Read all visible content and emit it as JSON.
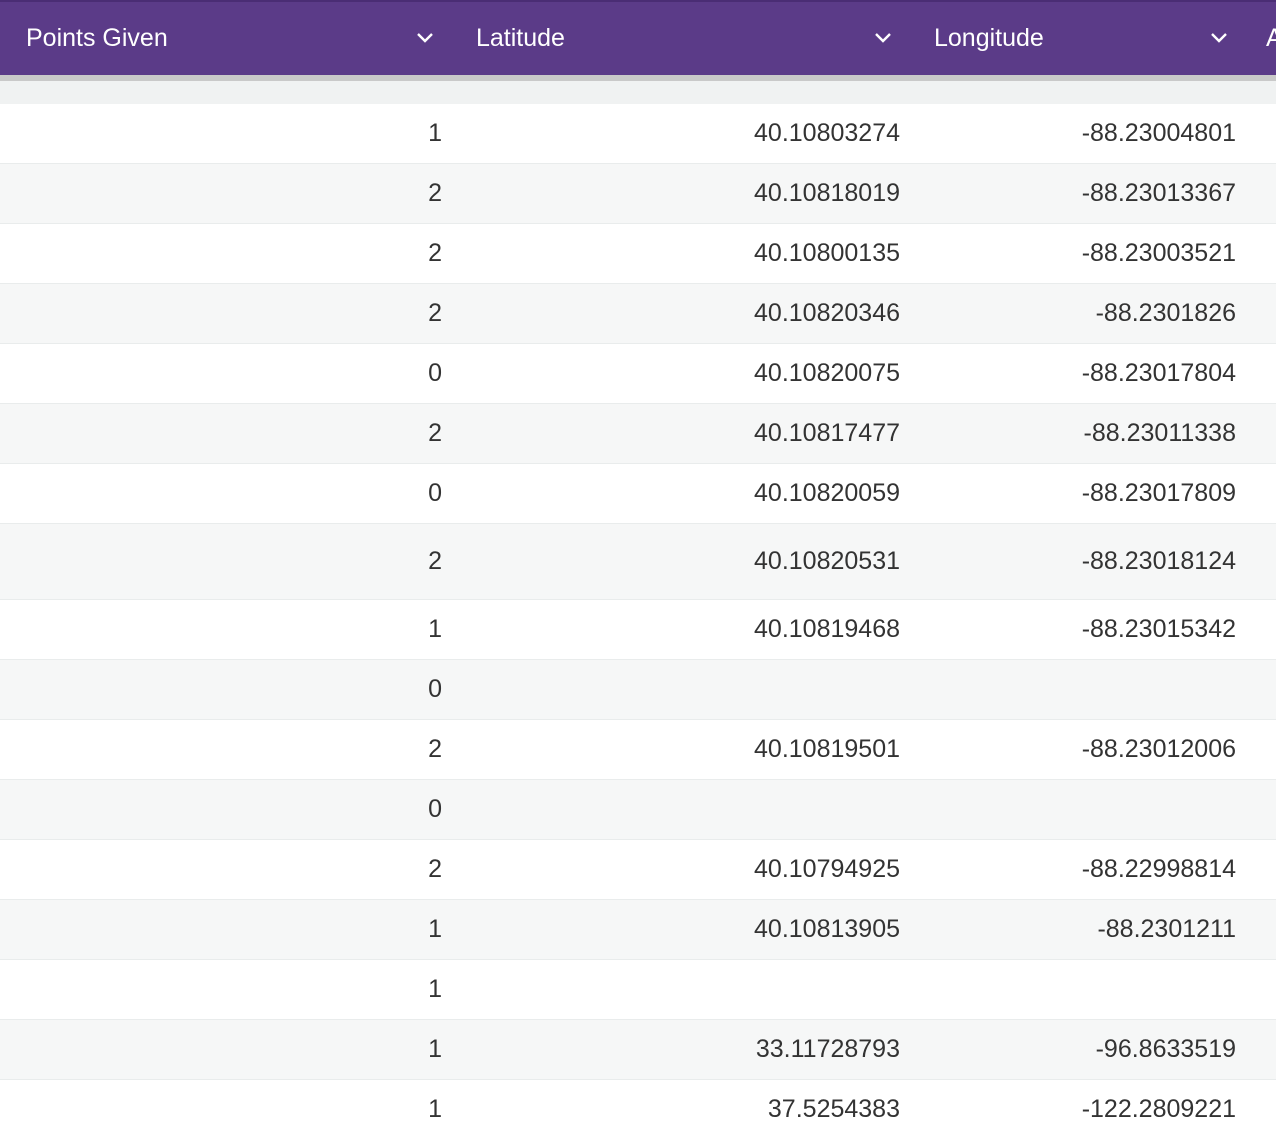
{
  "header": {
    "columns": [
      {
        "label": "Points Given",
        "icon": "chevron-down-icon"
      },
      {
        "label": "Latitude",
        "icon": "chevron-down-icon"
      },
      {
        "label": "Longitude",
        "icon": "chevron-down-icon"
      }
    ],
    "overflow_label": "A"
  },
  "colors": {
    "header_bg": "#5b3b88",
    "header_text": "#ffffff",
    "row_alt_bg": "#f6f7f7",
    "cell_text": "#333333"
  },
  "rows": [
    {
      "points": "1",
      "lat": "40.10803274",
      "lon": "-88.23004801"
    },
    {
      "points": "2",
      "lat": "40.10818019",
      "lon": "-88.23013367"
    },
    {
      "points": "2",
      "lat": "40.10800135",
      "lon": "-88.23003521"
    },
    {
      "points": "2",
      "lat": "40.10820346",
      "lon": "-88.2301826"
    },
    {
      "points": "0",
      "lat": "40.10820075",
      "lon": "-88.23017804"
    },
    {
      "points": "2",
      "lat": "40.10817477",
      "lon": "-88.23011338"
    },
    {
      "points": "0",
      "lat": "40.10820059",
      "lon": "-88.23017809"
    },
    {
      "points": "2",
      "lat": "40.10820531",
      "lon": "-88.23018124"
    },
    {
      "points": "1",
      "lat": "40.10819468",
      "lon": "-88.23015342"
    },
    {
      "points": "0",
      "lat": "",
      "lon": ""
    },
    {
      "points": "2",
      "lat": "40.10819501",
      "lon": "-88.23012006"
    },
    {
      "points": "0",
      "lat": "",
      "lon": ""
    },
    {
      "points": "2",
      "lat": "40.10794925",
      "lon": "-88.22998814"
    },
    {
      "points": "1",
      "lat": "40.10813905",
      "lon": "-88.2301211"
    },
    {
      "points": "1",
      "lat": "",
      "lon": ""
    },
    {
      "points": "1",
      "lat": "33.11728793",
      "lon": "-96.8633519"
    },
    {
      "points": "1",
      "lat": "37.5254383",
      "lon": "-122.2809221"
    }
  ]
}
